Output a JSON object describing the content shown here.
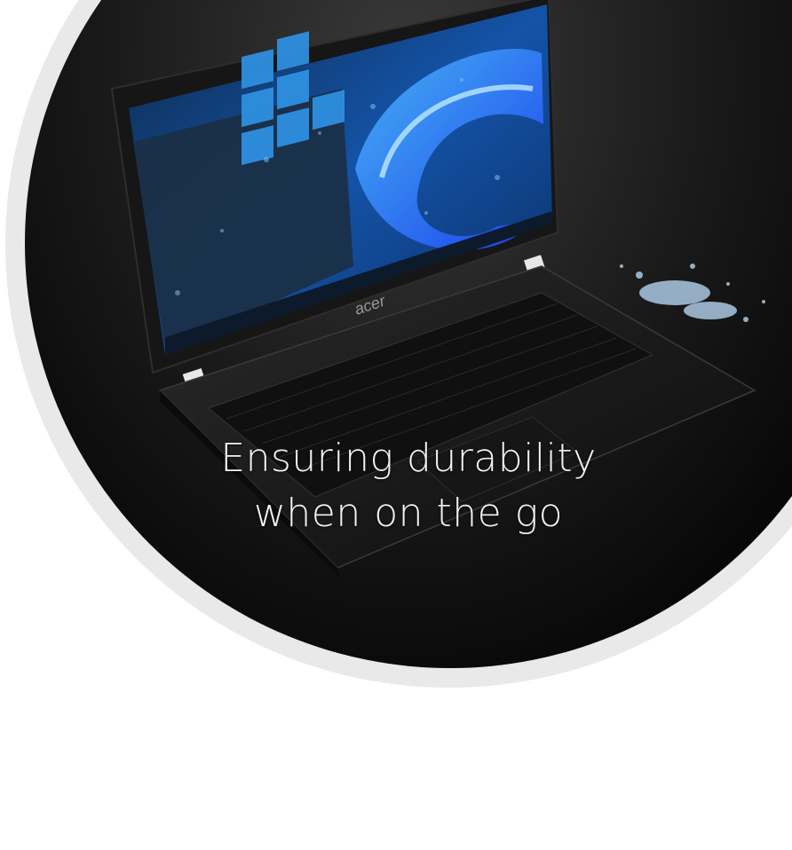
{
  "hero": {
    "headline_line1": "Ensuring durability",
    "headline_line2": "when on the go",
    "brand_logo_text": "acer"
  },
  "colors": {
    "background": "#ffffff",
    "circle_ring": "#e9e9e9",
    "circle_dark": "#0a0a0a",
    "screen_blue": "#1a6fd6",
    "text": "#f2f2f2"
  }
}
